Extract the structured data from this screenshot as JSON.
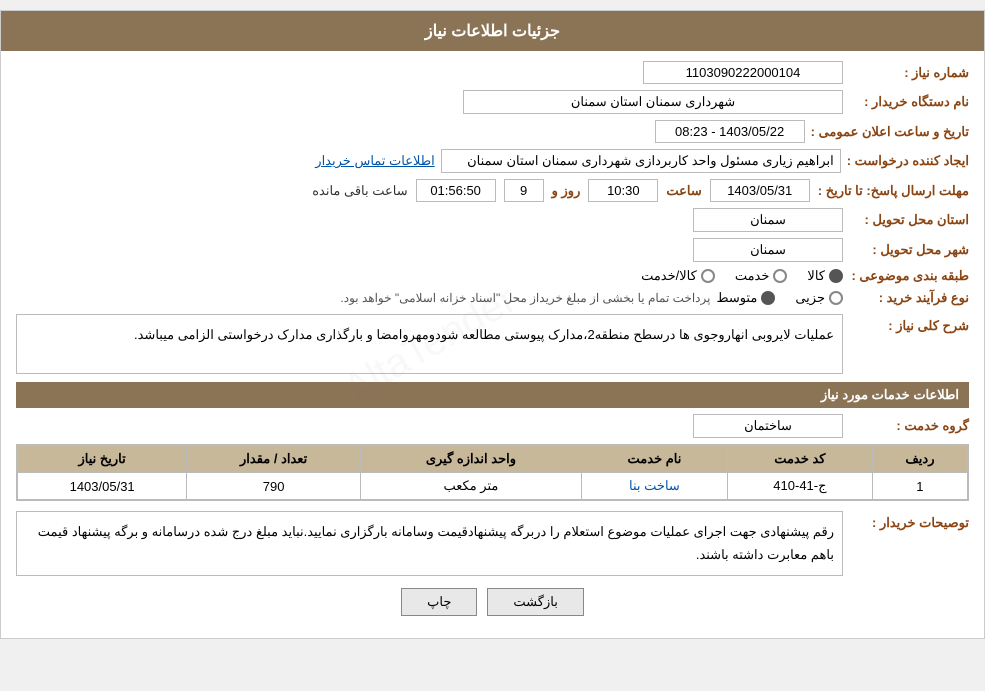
{
  "header": {
    "title": "جزئیات اطلاعات نیاز"
  },
  "fields": {
    "need_number_label": "شماره نیاز :",
    "need_number_value": "1103090222000104",
    "buyer_org_label": "نام دستگاه خریدار :",
    "buyer_org_value": "شهرداری سمنان استان سمنان",
    "announcement_label": "تاریخ و ساعت اعلان عمومی :",
    "announcement_value": "1403/05/22 - 08:23",
    "creator_label": "ایجاد کننده درخواست :",
    "creator_value": "ابراهیم زیاری مسئول واحد کاربردازی شهرداری سمنان استان سمنان",
    "contact_link": "اطلاعات تماس خریدار",
    "reply_deadline_label": "مهلت ارسال پاسخ: تا تاریخ :",
    "reply_date": "1403/05/31",
    "reply_time_label": "ساعت",
    "reply_time": "10:30",
    "reply_day_label": "روز و",
    "reply_days": "9",
    "reply_remain_label": "ساعت باقی مانده",
    "reply_remain": "01:56:50",
    "province_label": "استان محل تحویل :",
    "province_value": "سمنان",
    "city_label": "شهر محل تحویل :",
    "city_value": "سمنان",
    "category_label": "طبقه بندی موضوعی :",
    "category_options": [
      "کالا",
      "خدمت",
      "کالا/خدمت"
    ],
    "category_selected": "کالا",
    "process_label": "نوع فرآیند خرید :",
    "process_options": [
      "جزیی",
      "متوسط"
    ],
    "process_note": "پرداخت تمام یا بخشی از مبلغ خریداز محل \"اسناد خزانه اسلامی\" خواهد بود.",
    "description_label": "شرح کلی نیاز :",
    "description_value": "عملیات لایروبی انهاروجوی ها درسطح منطقه2،مدارک پیوستی مطالعه شودومهروامضا و بارگذاری مدارک درخواستی الزامی میباشد.",
    "service_info_header": "اطلاعات خدمات مورد نیاز",
    "service_group_label": "گروه خدمت :",
    "service_group_value": "ساختمان",
    "table_headers": [
      "ردیف",
      "کد خدمت",
      "نام خدمت",
      "واحد اندازه گیری",
      "تعداد / مقدار",
      "تاریخ نیاز"
    ],
    "table_rows": [
      {
        "row": "1",
        "code": "ج-41-410",
        "name": "ساخت بنا",
        "unit": "متر مکعب",
        "qty": "790",
        "date": "1403/05/31"
      }
    ],
    "buyer_note_label": "توصیحات خریدار :",
    "buyer_note_value": "رقم پیشنهادی جهت اجرای عملیات موضوع استعلام را دربرگه پیشنهادقیمت وسامانه بارگزاری نمایید.نباید مبلغ درج شده درسامانه و برگه پیشنهاد قیمت باهم معابرت داشته باشند."
  },
  "buttons": {
    "print": "چاپ",
    "back": "بازگشت"
  }
}
